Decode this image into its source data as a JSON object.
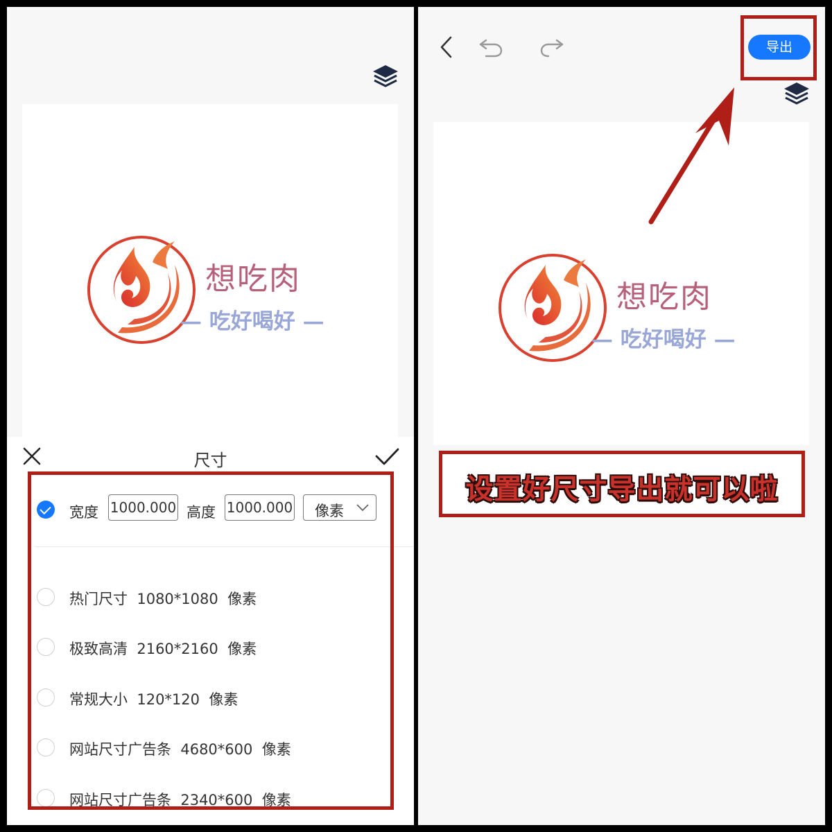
{
  "left": {
    "logo": {
      "brand_name": "想吃肉",
      "slogan": "— 吃好喝好 —"
    },
    "size_sheet": {
      "title": "尺寸",
      "custom": {
        "width_label": "宽度",
        "width_value": "1000.000",
        "height_label": "高度",
        "height_value": "1000.000",
        "unit": "像素",
        "selected": true
      },
      "presets": [
        {
          "text": "热门尺寸  1080*1080  像素"
        },
        {
          "text": "极致高清  2160*2160  像素"
        },
        {
          "text": "常规大小  120*120  像素"
        },
        {
          "text": "网站尺寸广告条  4680*600  像素"
        },
        {
          "text": "网站尺寸广告条  2340*600  像素"
        }
      ]
    }
  },
  "right": {
    "export_label": "导出",
    "logo": {
      "brand_name": "想吃肉",
      "slogan": "— 吃好喝好 —"
    },
    "callout_text": "设置好尺寸导出就可以啦"
  },
  "colors": {
    "accent": "#1677ff",
    "annotation_red": "#b01f17",
    "brand_name": "#b6607a",
    "slogan": "#98a6d8"
  },
  "icons": {
    "layers": "layers-icon",
    "close": "close-icon",
    "confirm": "check-icon",
    "back": "chevron-left-icon",
    "undo": "undo-icon",
    "redo": "redo-icon",
    "dropdown": "chevron-down-icon"
  }
}
